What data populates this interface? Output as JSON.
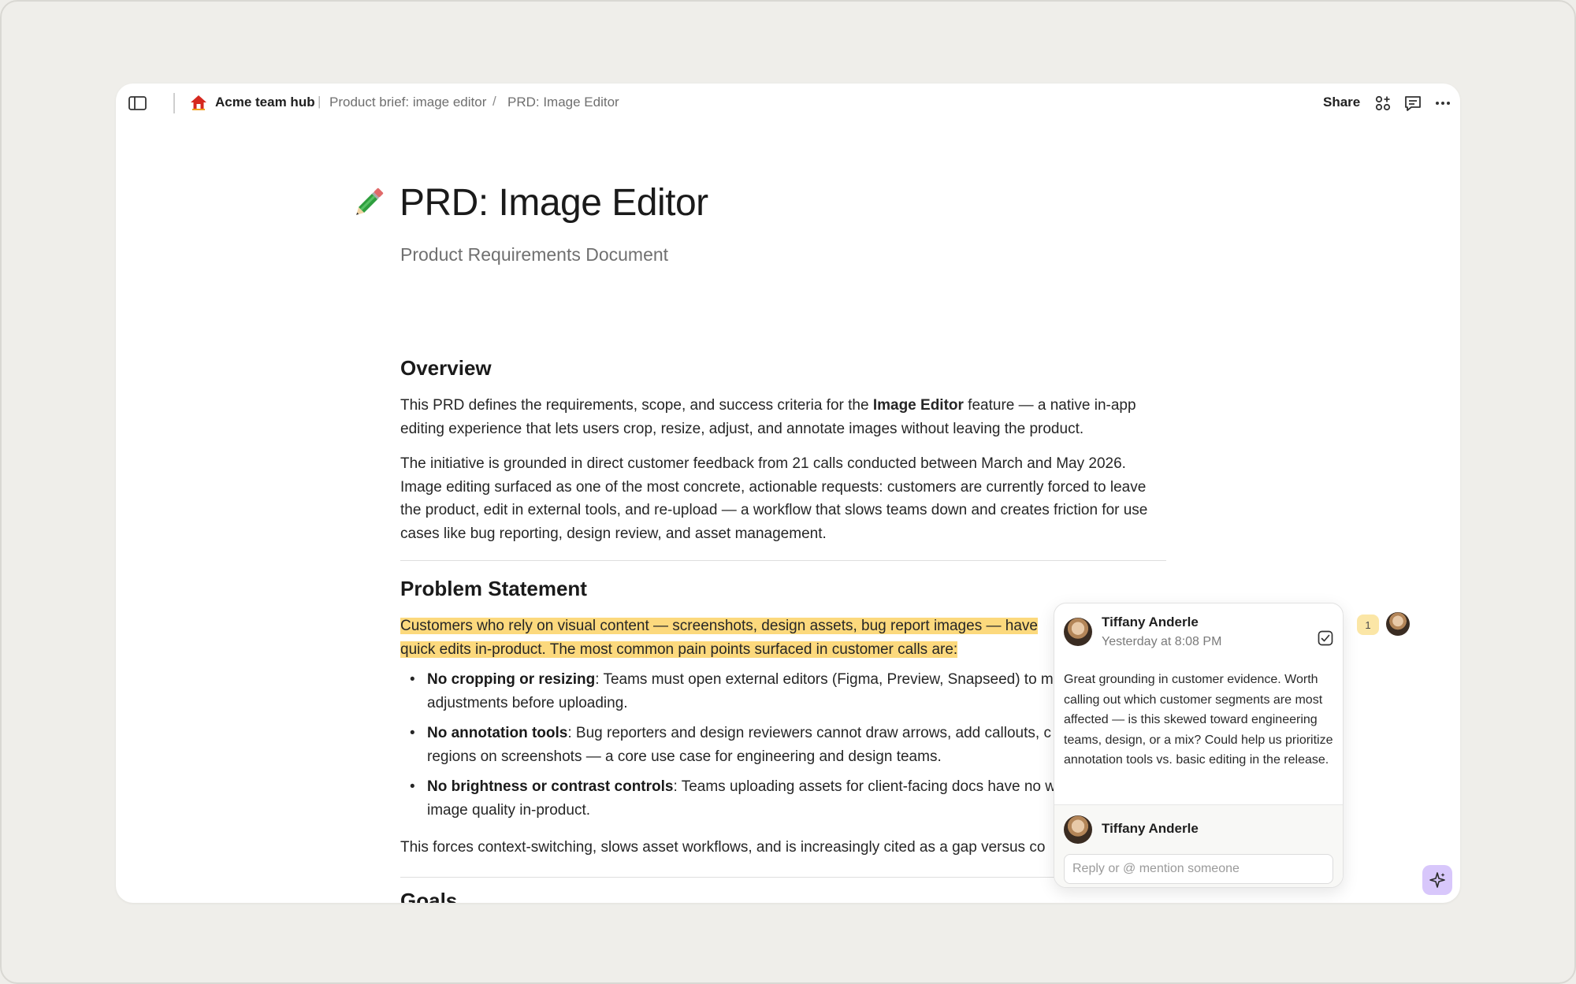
{
  "topbar": {
    "hub_name": "Acme team hub",
    "separator": "|",
    "breadcrumb": [
      "Product brief: image editor",
      "PRD: Image Editor"
    ],
    "breadcrumb_separator": "/",
    "share_label": "Share",
    "icons": [
      "sidebar-toggle-icon",
      "house-icon",
      "apps-icon",
      "comments-icon",
      "more-icon"
    ]
  },
  "document": {
    "icon": "pencil-icon",
    "title": "PRD: Image Editor",
    "subtitle": "Product Requirements Document",
    "overview": {
      "heading": "Overview",
      "p1_before": "This PRD defines the requirements, scope, and success criteria for the ",
      "p1_bold": "Image Editor",
      "p1_after": " feature — a native in-app editing experience that lets users crop, resize, adjust, and annotate images without leaving the product.",
      "p2": "The initiative is grounded in direct customer feedback from 21 calls conducted between March and May 2026. Image editing surfaced as one of the most concrete, actionable requests: customers are currently forced to leave the product, edit in external tools, and re-upload — a workflow that slows teams down and creates friction for use cases like bug reporting, design review, and asset management."
    },
    "problem": {
      "heading": "Problem Statement",
      "highlight_line1": "Customers who rely on visual content — screenshots, design assets, bug report images — have",
      "highlight_line2": "quick edits in-product. The most common pain points surfaced in customer calls are:",
      "bullets": [
        {
          "bold": "No cropping or resizing",
          "line1": ": Teams must open external editors (Figma, Preview, Snapseed) to m",
          "line2": "adjustments before uploading."
        },
        {
          "bold": "No annotation tools",
          "line1": ": Bug reporters and design reviewers cannot draw arrows, add callouts, c",
          "line2": "regions on screenshots — a core use case for engineering and design teams."
        },
        {
          "bold": "No brightness or contrast controls",
          "line1": ": Teams uploading assets for client-facing docs have no w",
          "line2": "image quality in-product."
        }
      ],
      "closing": "This forces context-switching, slows asset workflows, and is increasingly cited as a gap versus co"
    },
    "next_heading": "Goals"
  },
  "comment": {
    "author": "Tiffany Anderle",
    "time": "Yesterday at 8:08 PM",
    "body": "Great grounding in customer evidence. Worth calling out which customer segments are most affected — is this skewed toward engineering teams, design, or a mix? Could help us prioritize annotation tools vs. basic editing in the release.",
    "reply_author": "Tiffany Anderle",
    "reply_placeholder": "Reply or @ mention someone",
    "count": "1"
  },
  "colors": {
    "highlight": "#fcd97d",
    "badge": "#fbe6a6",
    "ai_button": "#d8c7fb",
    "hub_icon": "#d6281f"
  }
}
